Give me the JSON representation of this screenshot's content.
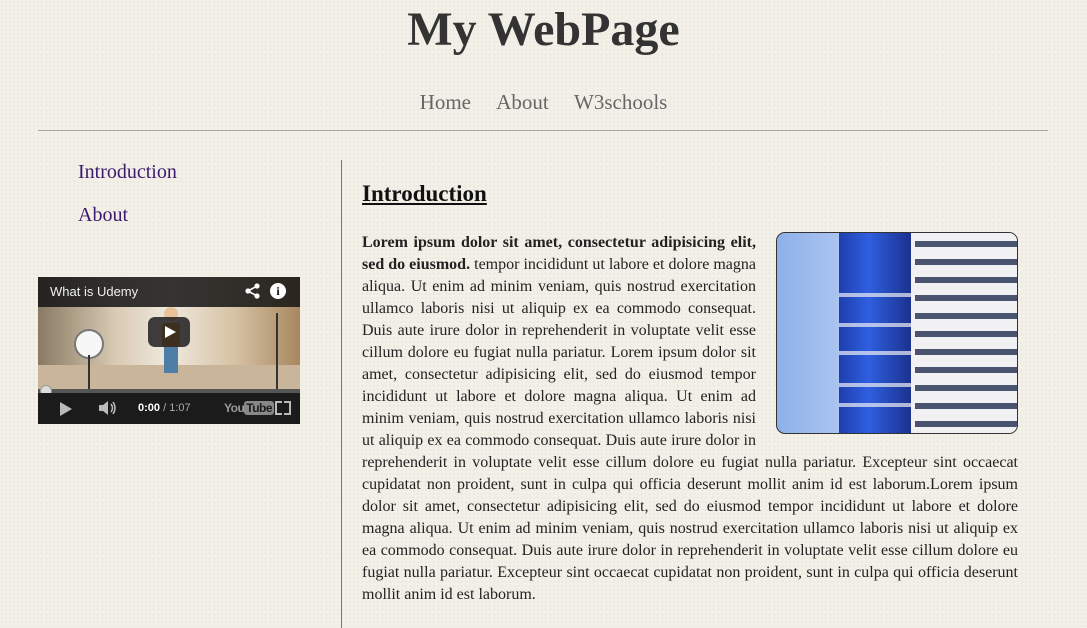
{
  "site": {
    "title": "My WebPage"
  },
  "top_nav": [
    {
      "label": "Home"
    },
    {
      "label": "About"
    },
    {
      "label": "W3schools"
    }
  ],
  "side_nav": [
    {
      "label": "Introduction"
    },
    {
      "label": "About"
    }
  ],
  "video": {
    "title": "What is Udemy",
    "time_current": "0:00",
    "time_total": "/ 1:07",
    "brand": "YouTube",
    "brand_you": "You",
    "brand_tube": "Tube"
  },
  "article": {
    "heading": "Introduction",
    "lead_bold": "Lorem ipsum dolor sit amet, consectetur adipisicing elit, sed do eiusmod.",
    "body": " tempor incididunt ut labore et dolore magna aliqua. Ut enim ad minim veniam, quis nostrud exercitation ullamco laboris nisi ut aliquip ex ea commodo consequat. Duis aute irure dolor in reprehenderit in voluptate velit esse cillum dolore eu fugiat nulla pariatur. Lorem ipsum dolor sit amet, consectetur adipisicing elit, sed do eiusmod tempor incididunt ut labore et dolore magna aliqua. Ut enim ad minim veniam, quis nostrud exercitation ullamco laboris nisi ut aliquip ex ea commodo consequat. Duis aute irure dolor in reprehenderit in voluptate velit esse cillum dolore eu fugiat nulla pariatur. Excepteur sint occaecat cupidatat non proident, sunt in culpa qui officia deserunt mollit anim id est laborum.Lorem ipsum dolor sit amet, consectetur adipisicing elit, sed do eiusmod tempor incididunt ut labore et dolore magna aliqua. Ut enim ad minim veniam, quis nostrud exercitation ullamco laboris nisi ut aliquip ex ea commodo consequat. Duis aute irure dolor in reprehenderit in voluptate velit esse cillum dolore eu fugiat nulla pariatur. Excepteur sint occaecat cupidatat non proident, sunt in culpa qui officia deserunt mollit anim id est laborum."
  },
  "colors": {
    "background": "#f3f0e8",
    "title": "#333333",
    "top_nav_link": "#666666",
    "side_nav_link": "#3b1a6e",
    "building_blue": "#2f5fe0"
  },
  "icons": {
    "share": "share-icon",
    "info": "info-icon",
    "play": "play-icon",
    "volume": "volume-icon",
    "fullscreen": "fullscreen-icon"
  }
}
